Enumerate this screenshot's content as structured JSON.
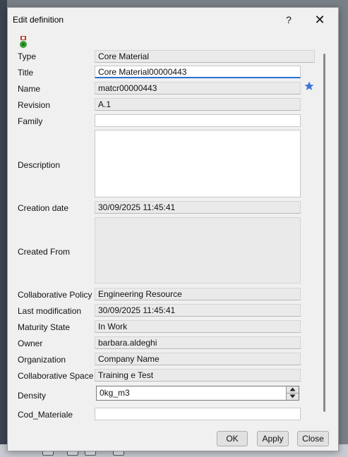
{
  "window": {
    "title": "Edit definition",
    "help_label": "?",
    "close_label": "✕"
  },
  "icons": {
    "type_icon": "core-material-icon",
    "favorite_icon": "star-icon"
  },
  "labels": {
    "type": "Type",
    "title": "Title",
    "name": "Name",
    "revision": "Revision",
    "family": "Family",
    "description": "Description",
    "creation_date": "Creation date",
    "created_from": "Created From",
    "collaborative_policy": "Collaborative Policy",
    "last_modification": "Last modification",
    "maturity_state": "Maturity State",
    "owner": "Owner",
    "organization": "Organization",
    "collaborative_space": "Collaborative Space",
    "density": "Density",
    "cod_materiale": "Cod_Materiale"
  },
  "values": {
    "type": "Core Material",
    "title": "Core Material00000443",
    "name": "matcr00000443",
    "revision": "A.1",
    "family": "",
    "description": "",
    "creation_date": "30/09/2025 11:45:41",
    "created_from": "",
    "collaborative_policy": "Engineering Resource",
    "last_modification": "30/09/2025 11:45:41",
    "maturity_state": "In Work",
    "owner": "barbara.aldeghi",
    "organization": "Company Name",
    "collaborative_space": "Training e Test",
    "density": "0kg_m3",
    "cod_materiale": ""
  },
  "buttons": {
    "ok": "OK",
    "apply": "Apply",
    "close": "Close"
  },
  "colors": {
    "focus_accent": "#2a6fd6",
    "star": "#3a78d8",
    "icon_green": "#3aa035",
    "icon_red": "#c0392b"
  }
}
